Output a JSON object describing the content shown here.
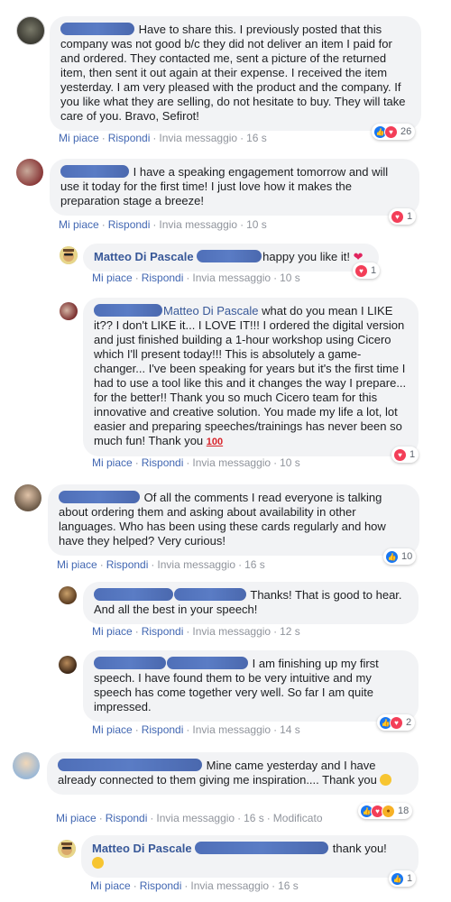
{
  "actions": {
    "like": "Mi piace",
    "reply": "Rispondi",
    "message": "Invia messaggio",
    "edited": "Modificato"
  },
  "comments": [
    {
      "text": "Have to share this. I previously posted that this company was not good b/c they did not deliver an item I paid for and ordered. They contacted me, sent a picture of the returned item, then sent it out again at their expense. I received the item yesterday. I am very pleased with the product and the company. If you like what they are selling, do not hesitate to buy. They will take care of you. Bravo, Sefirot!",
      "time": "16 s",
      "reactions": [
        "like",
        "love"
      ],
      "count": "26"
    },
    {
      "text": "I have a speaking engagement tomorrow and will use it today for the first time! I just love how it makes the preparation stage a breeze!",
      "time": "10 s",
      "reactions": [
        "love"
      ],
      "count": "1"
    },
    {
      "author": "Matteo Di Pascale",
      "text": "happy you like it!",
      "emoji": "heart",
      "time": "10 s",
      "reactions": [
        "love"
      ],
      "count": "1"
    },
    {
      "tag": "Matteo Di Pascale",
      "text": " what do you mean I LIKE it?? I don't LIKE it... I LOVE IT!!! I ordered the digital version and just finished building a 1-hour workshop using Cicero which I'll present today!!! This is absolutely a game-changer... I've been speaking for years but it's the first time I had to use a tool like this and it changes the way I prepare... for the better!! Thank you so much Cicero team for this innovative and creative solution. You made my life a lot, lot easier and preparing speeches/trainings has never been so much fun! Thank you ",
      "emoji": "100",
      "time": "10 s",
      "reactions": [
        "love"
      ],
      "count": "1"
    },
    {
      "text": "Of all the comments I read everyone is talking about ordering them and asking about availability in other languages. Who has been using these cards regularly and how have they helped? Very curious!",
      "time": "16 s",
      "reactions": [
        "like"
      ],
      "count": "10"
    },
    {
      "text": "Thanks! That is good to hear. And all the best in your speech!",
      "time": "12 s"
    },
    {
      "text": "I am finishing up my first speech. I have found them to be very intuitive and my speech has come together very well. So far I am quite impressed.",
      "time": "14 s",
      "reactions": [
        "like",
        "love"
      ],
      "count": "2"
    },
    {
      "text": "Mine came yesterday and I have already connected to them giving me inspiration.... Thank you",
      "emoji": "smile",
      "time": "16 s",
      "edited": true,
      "reactions": [
        "like",
        "love",
        "haha"
      ],
      "count": "18"
    },
    {
      "author": "Matteo Di Pascale",
      "text": "thank you!",
      "emoji": "smile",
      "time": "16 s",
      "reactions": [
        "like"
      ],
      "count": "1"
    }
  ]
}
